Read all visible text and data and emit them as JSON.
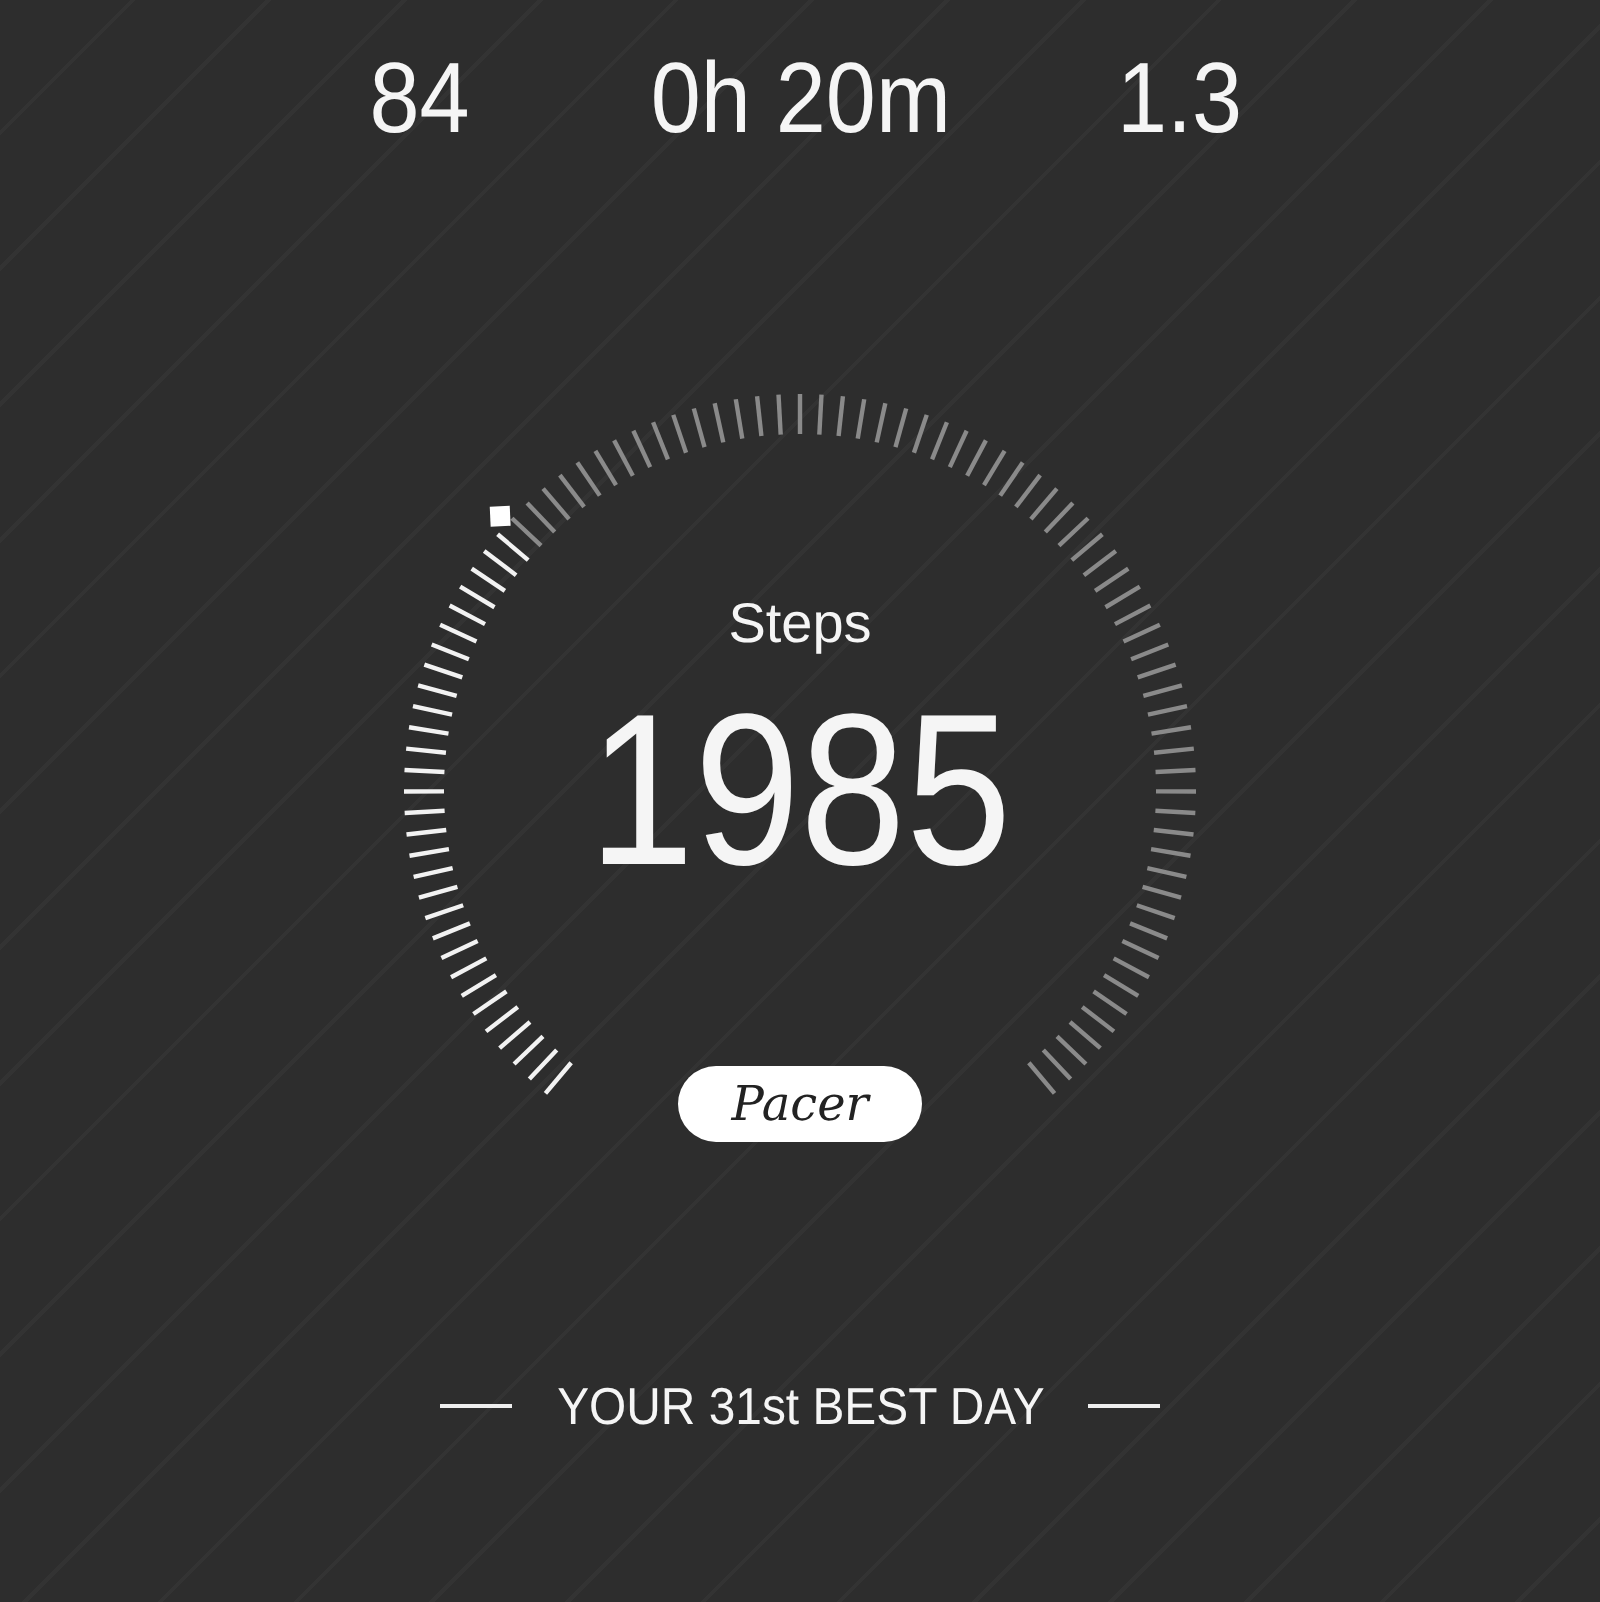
{
  "stats": [
    {
      "value": "84"
    },
    {
      "value": "0h 20m"
    },
    {
      "value": "1.3"
    }
  ],
  "steps": {
    "label": "Steps",
    "value": "1985"
  },
  "logo": "Pacer",
  "footer": {
    "text": "YOUR 31st BEST DAY"
  }
}
